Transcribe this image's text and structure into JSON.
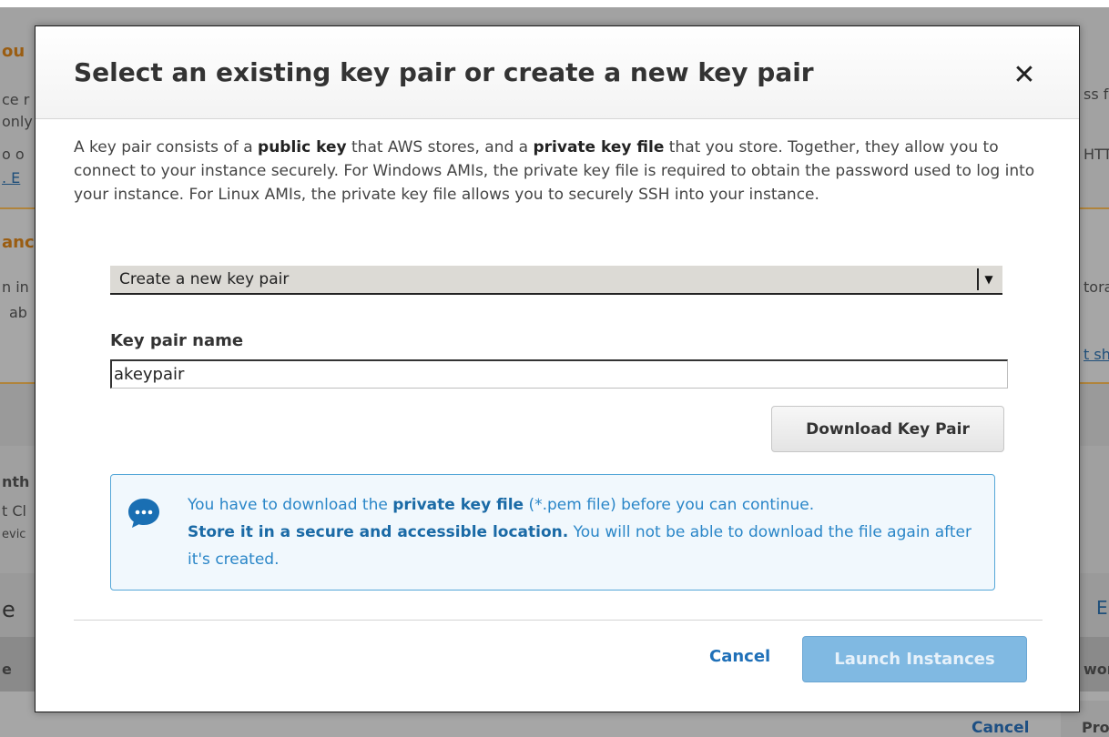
{
  "background": {
    "left_fragments": [
      "ou",
      "ce r",
      "only",
      "o o",
      ". E",
      "anc",
      "n in",
      "ab",
      "nth",
      "t Cl",
      "evic",
      "e",
      "e"
    ],
    "right_fragments": [
      "ss f",
      "HTT",
      "tora",
      "t sh",
      "E",
      "wor",
      "Pro"
    ],
    "cancel_label": "Cancel"
  },
  "modal": {
    "title": "Select an existing key pair or create a new key pair",
    "close_glyph": "✕",
    "intro": {
      "part1": "A key pair consists of a ",
      "bold1": "public key",
      "part2": " that AWS stores, and a ",
      "bold2": "private key file",
      "part3": " that you store. Together, they allow you to connect to your instance securely. For Windows AMIs, the private key file is required to obtain the password used to log into your instance. For Linux AMIs, the private key file allows you to securely SSH into your instance."
    },
    "key_pair_select": {
      "selected": "Create a new key pair",
      "arrow_glyph": "▼"
    },
    "key_pair_name": {
      "label": "Key pair name",
      "value": "akeypair",
      "placeholder": ""
    },
    "download_button": "Download Key Pair",
    "info": {
      "icon": "chat-bubble-icon",
      "part1": "You have to download the ",
      "bold1": "private key file",
      "part2": " (*.pem file) before you can continue. ",
      "bold2": "Store it in a secure and accessible location.",
      "part3": " You will not be able to download the file again after it's created."
    },
    "cancel_label": "Cancel",
    "launch_label": "Launch Instances"
  },
  "colors": {
    "overlay": "#9a9a9a",
    "info_border": "#55a7d8",
    "info_text": "#2a86c8",
    "launch_disabled": "#80b9e2",
    "link": "#1f70b8"
  }
}
